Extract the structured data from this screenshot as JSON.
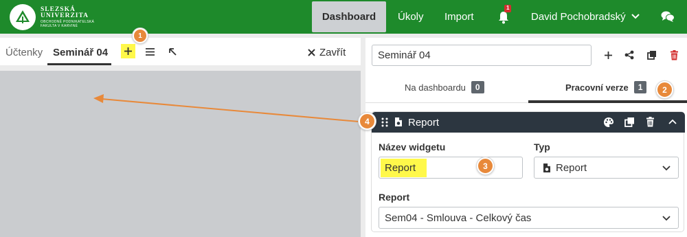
{
  "logo": {
    "line1": "SLEZSKÁ",
    "line2": "UNIVERZITA",
    "line3": "OBCHODNĚ PODNIKATELSKÁ",
    "line4": "FAKULTA V KARVINÉ"
  },
  "nav": {
    "dashboard": "Dashboard",
    "ukoly": "Úkoly",
    "import": "Import",
    "notifications_count": "1",
    "user": "David Pochobradský"
  },
  "left": {
    "tabs": [
      "Účtenky",
      "Seminář 04"
    ],
    "close_label": "Zavřít"
  },
  "right": {
    "dashboard_name": "Seminář 04",
    "subtabs": [
      {
        "label": "Na dashboardu",
        "count": "0"
      },
      {
        "label": "Pracovní verze",
        "count": "1"
      }
    ],
    "widget": {
      "title": "Report",
      "name_label": "Název widgetu",
      "name_value": "Report",
      "type_label": "Typ",
      "type_value": "Report",
      "report_label": "Report",
      "report_value": "Sem04 - Smlouva - Celkový čas"
    }
  },
  "callouts": [
    "1",
    "2",
    "3",
    "4"
  ],
  "colors": {
    "header": "#1e8a2b",
    "highlight": "#fff84a",
    "callout": "#e8893a",
    "widget_header": "#2c3640",
    "trash": "#d32f2f"
  }
}
